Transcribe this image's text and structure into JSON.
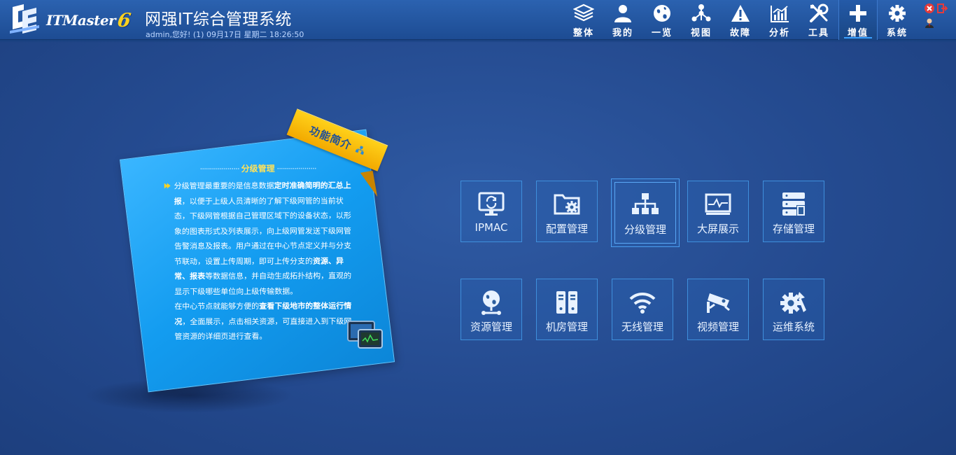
{
  "header": {
    "brand": "ITMaster",
    "brand_version": "6",
    "title": "网强IT综合管理系统",
    "user_line": "admin,您好! (1) 09月17日 星期二 18:26:50",
    "nav": [
      {
        "label": "整体",
        "icon": "layers-icon"
      },
      {
        "label": "我的",
        "icon": "user-icon"
      },
      {
        "label": "一览",
        "icon": "globe-icon"
      },
      {
        "label": "视图",
        "icon": "topology-icon"
      },
      {
        "label": "故障",
        "icon": "warning-icon"
      },
      {
        "label": "分析",
        "icon": "chart-icon"
      },
      {
        "label": "工具",
        "icon": "tools-icon"
      },
      {
        "label": "增值",
        "icon": "plus-icon"
      },
      {
        "label": "系统",
        "icon": "gear-icon"
      }
    ],
    "active_nav": "增值"
  },
  "intro": {
    "ribbon": "功能简介",
    "section_title": "分级管理",
    "p1_a": "分级管理最重要的是信息数据",
    "p1_b": "定时准确简明的汇总上报",
    "p1_c": "，以便于上级人员清晰的了解下级网管的当前状态，下级网管根据自己管理区域下的设备状态，以形象的图表形式及列表展示，向上级网管发送下级网管告警消息及报表。用户通过在中心节点定义并与分支节联动，设置上传周期，即可上传分支的",
    "p1_d": "资源",
    "p1_e": "、",
    "p1_f": "异常",
    "p1_g": "、",
    "p1_h": "报表",
    "p1_i": "等数据信息，并自动生成拓扑结构，直观的显示下级哪些单位向上级传输数据。",
    "p2_a": "在中心节点就能够方便的",
    "p2_b": "查看下级地市的整体运行情况",
    "p2_c": "，全面展示，点击相关资源，可直接进入到下级网管资源的详细页进行查看。"
  },
  "tiles": [
    {
      "label": "IPMAC",
      "icon": "monitor-cycle-icon"
    },
    {
      "label": "配置管理",
      "icon": "folder-gear-icon"
    },
    {
      "label": "分级管理",
      "icon": "hierarchy-icon"
    },
    {
      "label": "大屏展示",
      "icon": "wave-screen-icon"
    },
    {
      "label": "存储管理",
      "icon": "storage-icon"
    },
    {
      "label": "资源管理",
      "icon": "globe-stand-icon"
    },
    {
      "label": "机房管理",
      "icon": "server-rack-icon"
    },
    {
      "label": "无线管理",
      "icon": "wifi-icon"
    },
    {
      "label": "视频管理",
      "icon": "camera-icon"
    },
    {
      "label": "运维系统",
      "icon": "gears-icon"
    }
  ],
  "selected_tile": "分级管理",
  "colors": {
    "background": "#244a8f",
    "card": "#139cf0",
    "ribbon": "#ffd11a",
    "accent_text": "#ffe25a"
  }
}
